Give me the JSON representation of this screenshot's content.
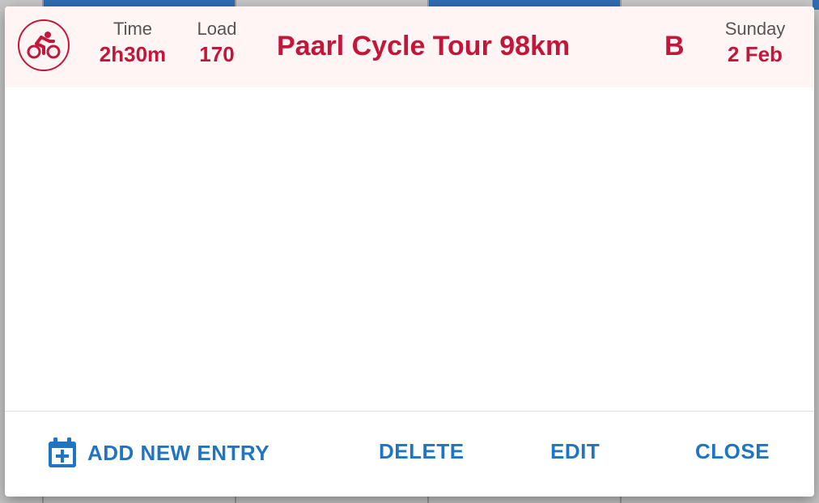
{
  "event": {
    "icon": "bicycle-icon",
    "time_label": "Time",
    "time_value": "2h30m",
    "load_label": "Load",
    "load_value": "170",
    "title": "Paarl Cycle Tour 98km",
    "priority": "B",
    "day_label": "Sunday",
    "date_value": "2 Feb"
  },
  "actions": {
    "add_label": "ADD NEW ENTRY",
    "delete_label": "DELETE",
    "edit_label": "EDIT",
    "close_label": "CLOSE"
  },
  "colors": {
    "accent": "#c3163b",
    "action": "#1f74c4",
    "header_bg": "#fff5f5"
  }
}
